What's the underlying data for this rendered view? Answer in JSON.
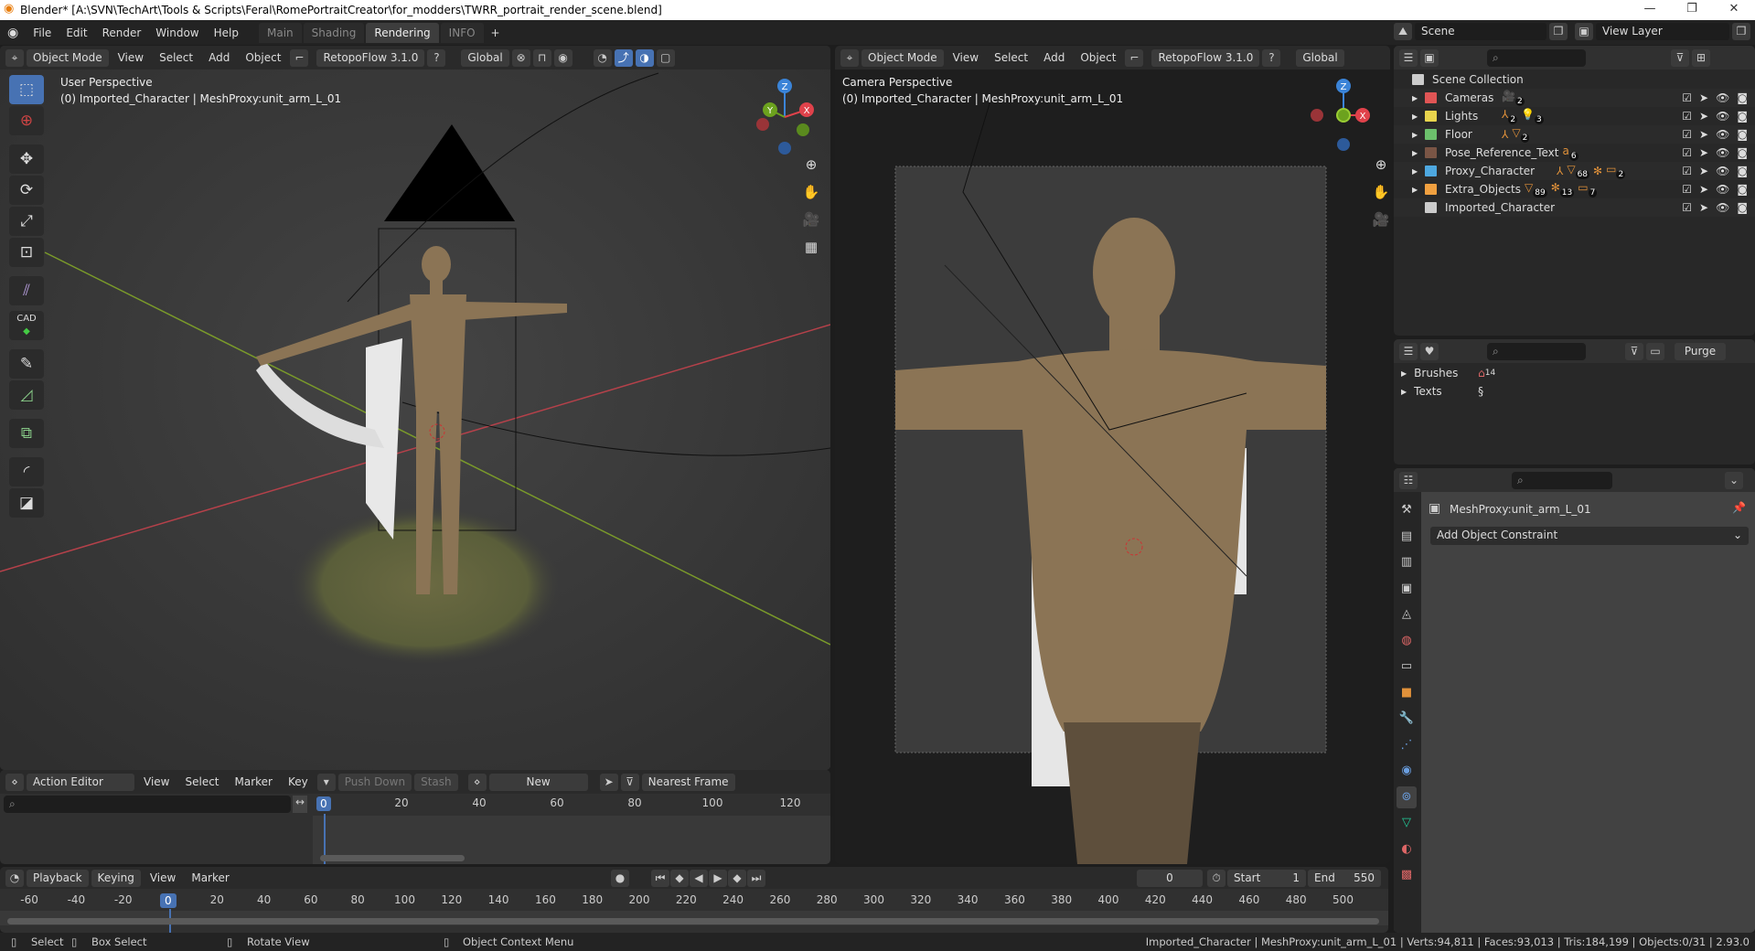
{
  "window": {
    "title": "Blender* [A:\\SVN\\TechArt\\Tools & Scripts\\Feral\\RomePortraitCreator\\for_modders\\TWRR_portrait_render_scene.blend]",
    "minimize": "—",
    "maximize": "❐",
    "close": "✕"
  },
  "menu": {
    "items": [
      "File",
      "Edit",
      "Render",
      "Window",
      "Help"
    ],
    "workspaces": [
      "Main",
      "Shading",
      "Rendering",
      "INFO"
    ],
    "active_workspace": "Rendering",
    "add_workspace": "+"
  },
  "scene": {
    "name": "Scene",
    "view_layer": "View Layer"
  },
  "viewport_left": {
    "mode": "Object Mode",
    "menus": [
      "View",
      "Select",
      "Add",
      "Object"
    ],
    "addon": "RetopoFlow 3.1.0",
    "orientation": "Global",
    "perspective": "User Perspective",
    "info": "(0) Imported_Character | MeshProxy:unit_arm_L_01"
  },
  "viewport_right": {
    "mode": "Object Mode",
    "menus": [
      "View",
      "Select",
      "Add",
      "Object"
    ],
    "addon": "RetopoFlow 3.1.0",
    "orientation": "Global",
    "perspective": "Camera Perspective",
    "info": "(0) Imported_Character | MeshProxy:unit_arm_L_01"
  },
  "gizmo": {
    "x": "X",
    "y": "Y",
    "z": "Z",
    "x_color": "#e0424b",
    "y_color": "#6ca21e",
    "z_color": "#3b84d8"
  },
  "tools": [
    "select-box",
    "cursor",
    "move",
    "rotate",
    "scale",
    "transform",
    "annotate-lines",
    "cad",
    "annotate",
    "measure",
    "add-cube",
    "bevel",
    "shear"
  ],
  "tools_labels": {
    "cad": "CAD"
  },
  "outliner": {
    "root": "Scene Collection",
    "collections": [
      {
        "name": "Cameras",
        "color": "#e05555",
        "badges": [
          {
            "icon": "camera",
            "count": "2"
          }
        ]
      },
      {
        "name": "Lights",
        "color": "#e8d44d",
        "badges": [
          {
            "icon": "empty",
            "count": "2"
          },
          {
            "icon": "light",
            "count": "3"
          }
        ]
      },
      {
        "name": "Floor",
        "color": "#6cc06c",
        "badges": [
          {
            "icon": "empty",
            "count": ""
          },
          {
            "icon": "mesh",
            "count": "2"
          }
        ]
      },
      {
        "name": "Pose_Reference_Text",
        "color": "#7a5545",
        "badges": [
          {
            "icon": "text",
            "count": "6"
          }
        ]
      },
      {
        "name": "Proxy_Character",
        "color": "#4ea8e0",
        "badges": [
          {
            "icon": "empty",
            "count": ""
          },
          {
            "icon": "mesh",
            "count": "68"
          },
          {
            "icon": "armature",
            "count": ""
          },
          {
            "icon": "collection",
            "count": "2"
          }
        ]
      },
      {
        "name": "Extra_Objects",
        "color": "#f0a040",
        "badges": [
          {
            "icon": "mesh",
            "count": "89"
          },
          {
            "icon": "armature",
            "count": "13"
          },
          {
            "icon": "collection",
            "count": "7"
          }
        ]
      },
      {
        "name": "Imported_Character",
        "color": "#cccccc",
        "badges": []
      }
    ]
  },
  "blend_file": {
    "purge": "Purge",
    "items": [
      {
        "name": "Brushes",
        "count": "14"
      },
      {
        "name": "Texts",
        "count": ""
      }
    ]
  },
  "properties": {
    "object": "MeshProxy:unit_arm_L_01",
    "add_constraint": "Add Object Constraint",
    "active_tab": "constraints"
  },
  "action_editor": {
    "mode": "Action Editor",
    "menus": [
      "View",
      "Select",
      "Marker",
      "Key"
    ],
    "push_down": "Push Down",
    "stash": "Stash",
    "new": "New",
    "snap": "Nearest Frame",
    "current_frame": "0",
    "ticks": [
      "20",
      "40",
      "60",
      "80",
      "100",
      "120"
    ]
  },
  "timeline": {
    "menus": [
      "Playback",
      "Keying",
      "View",
      "Marker"
    ],
    "current_frame": "0",
    "frame_field": "0",
    "start_label": "Start",
    "start": "1",
    "end_label": "End",
    "end": "550",
    "ticks": [
      "-60",
      "-40",
      "-20",
      "20",
      "40",
      "60",
      "80",
      "100",
      "120",
      "140",
      "160",
      "180",
      "200",
      "220",
      "240",
      "260",
      "280",
      "300",
      "320",
      "340",
      "360",
      "380",
      "400",
      "420",
      "440",
      "460",
      "480",
      "500"
    ]
  },
  "status": {
    "select": "Select",
    "box_select": "Box Select",
    "rotate_view": "Rotate View",
    "context_menu": "Object Context Menu",
    "stats": "Imported_Character | MeshProxy:unit_arm_L_01 | Verts:94,811 | Faces:93,013 | Tris:184,199 | Objects:0/31 | 2.93.0"
  },
  "colors": {
    "accent": "#4772b3",
    "x_axis": "#b5414a",
    "y_axis": "#7a9a2a",
    "skin": "#8b7455"
  }
}
